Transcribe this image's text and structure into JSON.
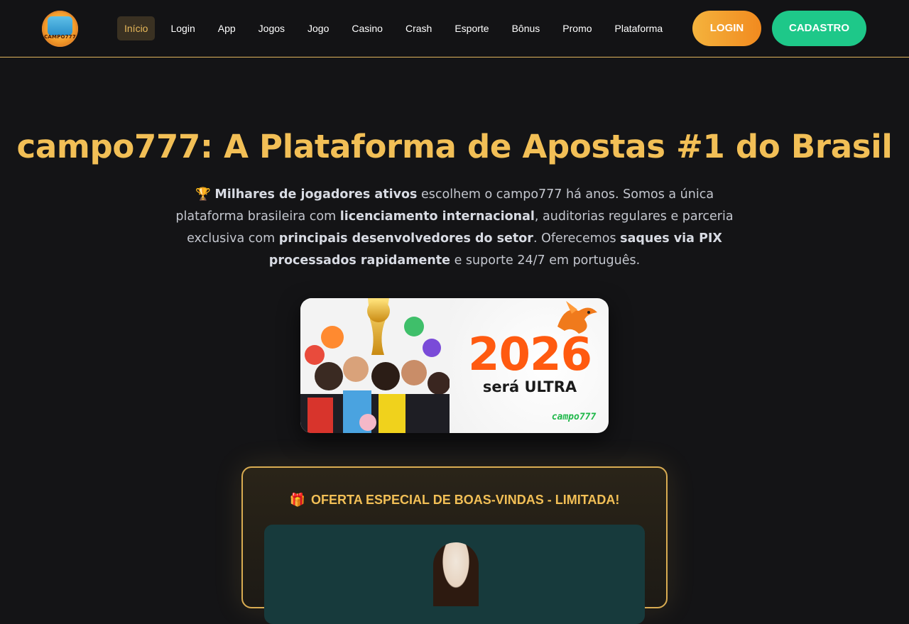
{
  "header": {
    "logo_text": "CAMPO777",
    "nav": [
      {
        "label": "Início",
        "active": true
      },
      {
        "label": "Login"
      },
      {
        "label": "App"
      },
      {
        "label": "Jogos"
      },
      {
        "label": "Jogo"
      },
      {
        "label": "Casino"
      },
      {
        "label": "Crash"
      },
      {
        "label": "Esporte"
      },
      {
        "label": "Bônus"
      },
      {
        "label": "Promo"
      },
      {
        "label": "Plataforma"
      }
    ],
    "login_label": "LOGIN",
    "register_label": "CADASTRO"
  },
  "hero": {
    "title": "campo777: A Plataforma de Apostas #1 do Brasil",
    "trophy_icon": "🏆",
    "desc": {
      "p1_bold": "Milhares de jogadores ativos",
      "p1": " escolhem o campo777 há anos. Somos a única plataforma brasileira com ",
      "p2_bold": "licenciamento internacional",
      "p2": ", auditorias regulares e parceria exclusiva com ",
      "p3_bold": "principais desenvolvedores do setor",
      "p3": ". Oferecemos ",
      "p4_bold": "saques via PIX processados rapidamente",
      "p4": " e suporte 24/7 em português."
    }
  },
  "banner": {
    "year": "2026",
    "tag_normal": "será ",
    "tag_bold": "ULTRA",
    "brand": "campo777"
  },
  "offer": {
    "gift_icon": "🎁",
    "title": "OFERTA ESPECIAL DE BOAS-VINDAS - LIMITADA!"
  },
  "colors": {
    "accent_gold": "#f2bf56",
    "login_orange": "#f18a1f",
    "register_green": "#1ec889",
    "background": "#141416"
  }
}
